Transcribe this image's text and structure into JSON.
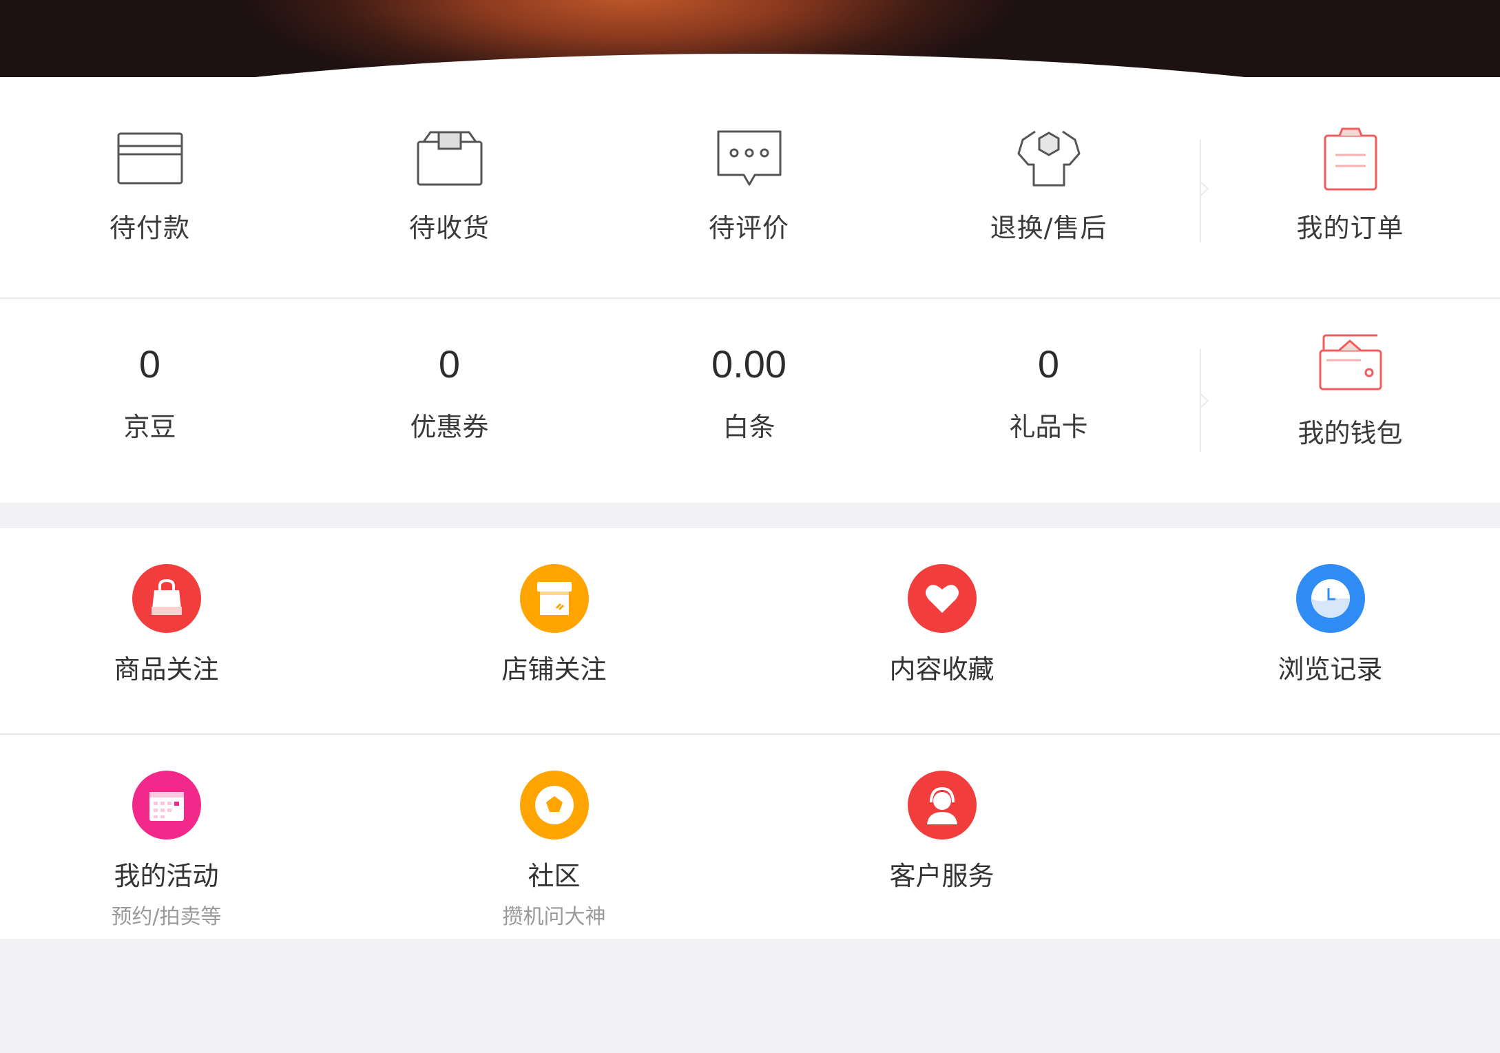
{
  "orders": {
    "items": [
      {
        "label": "待付款",
        "icon": "card-icon"
      },
      {
        "label": "待收货",
        "icon": "package-icon"
      },
      {
        "label": "待评价",
        "icon": "comment-icon"
      },
      {
        "label": "退换/售后",
        "icon": "wrench-icon"
      }
    ],
    "my_orders_label": "我的订单",
    "my_orders_icon": "clipboard-icon"
  },
  "assets": {
    "items": [
      {
        "value": "0",
        "label": "京豆"
      },
      {
        "value": "0",
        "label": "优惠券"
      },
      {
        "value": "0.00",
        "label": "白条"
      },
      {
        "value": "0",
        "label": "礼品卡"
      }
    ],
    "wallet_label": "我的钱包",
    "wallet_icon": "wallet-icon"
  },
  "tools": [
    {
      "label": "商品关注",
      "sub": "",
      "icon": "shopping-bag-icon",
      "color": "#f23d3d"
    },
    {
      "label": "店铺关注",
      "sub": "",
      "icon": "store-icon",
      "color": "#ffa400"
    },
    {
      "label": "内容收藏",
      "sub": "",
      "icon": "heart-icon",
      "color": "#f23d3d"
    },
    {
      "label": "浏览记录",
      "sub": "",
      "icon": "clock-icon",
      "color": "#2f8cf5"
    },
    {
      "label": "我的活动",
      "sub": "预约/拍卖等",
      "icon": "calendar-icon",
      "color": "#f2298a"
    },
    {
      "label": "社区",
      "sub": "攒机问大神",
      "icon": "community-icon",
      "color": "#ffa400"
    },
    {
      "label": "客户服务",
      "sub": "",
      "icon": "headset-icon",
      "color": "#f23d3d"
    }
  ],
  "colors": {
    "accent_red": "#f23d3d",
    "orange": "#ffa400",
    "blue": "#2f8cf5",
    "pink": "#f2298a",
    "background": "#f2f2f4"
  }
}
